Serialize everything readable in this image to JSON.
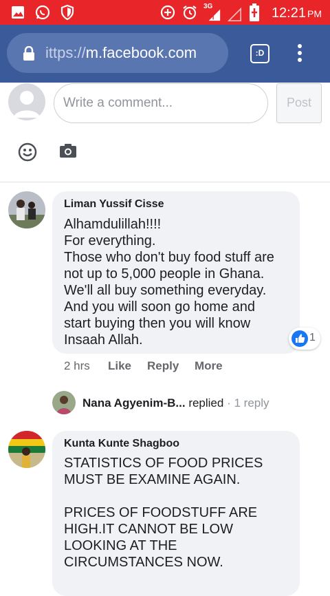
{
  "status_bar": {
    "icons": [
      "image-icon",
      "whatsapp-icon",
      "shield-icon",
      "data-saver-icon",
      "alarm-icon",
      "signal-icon",
      "battery-charging-icon"
    ],
    "network": "3G",
    "time": "12:21",
    "ampm": "PM",
    "bg_color": "#e8262a"
  },
  "browser": {
    "url_scheme": "ittps://",
    "url_host": "m.facebook.com",
    "tabs_label": ":D",
    "bar_color": "#3b5a9a"
  },
  "composer": {
    "placeholder": "Write a comment...",
    "post_label": "Post"
  },
  "comments": [
    {
      "author": "Liman Yussif Cisse",
      "text": "Alhamdulillah!!!!\nFor everything.\nThose who don't buy food stuff are\nnot up to 5,000 people in Ghana.\nWe'll all buy something everyday.\nAnd you will soon go home and\nstart buying then you will know\nInsaah Allah.",
      "reaction_count": "1",
      "time": "2 hrs",
      "like": "Like",
      "reply": "Reply",
      "more": "More",
      "reply_summary": {
        "author": "Nana Agyenim-B...",
        "action": "replied",
        "separator": "·",
        "count": "1 reply"
      }
    },
    {
      "author": "Kunta Kunte Shagboo",
      "text": "STATISTICS OF FOOD PRICES\nMUST BE EXAMINE AGAIN.\n\nPRICES OF FOODSTUFF ARE\nHIGH.IT CANNOT BE LOW\nLOOKING AT THE\nCIRCUMSTANCES NOW."
    }
  ],
  "colors": {
    "like_blue": "#1877f2",
    "bubble_bg": "#f0f2f5"
  }
}
